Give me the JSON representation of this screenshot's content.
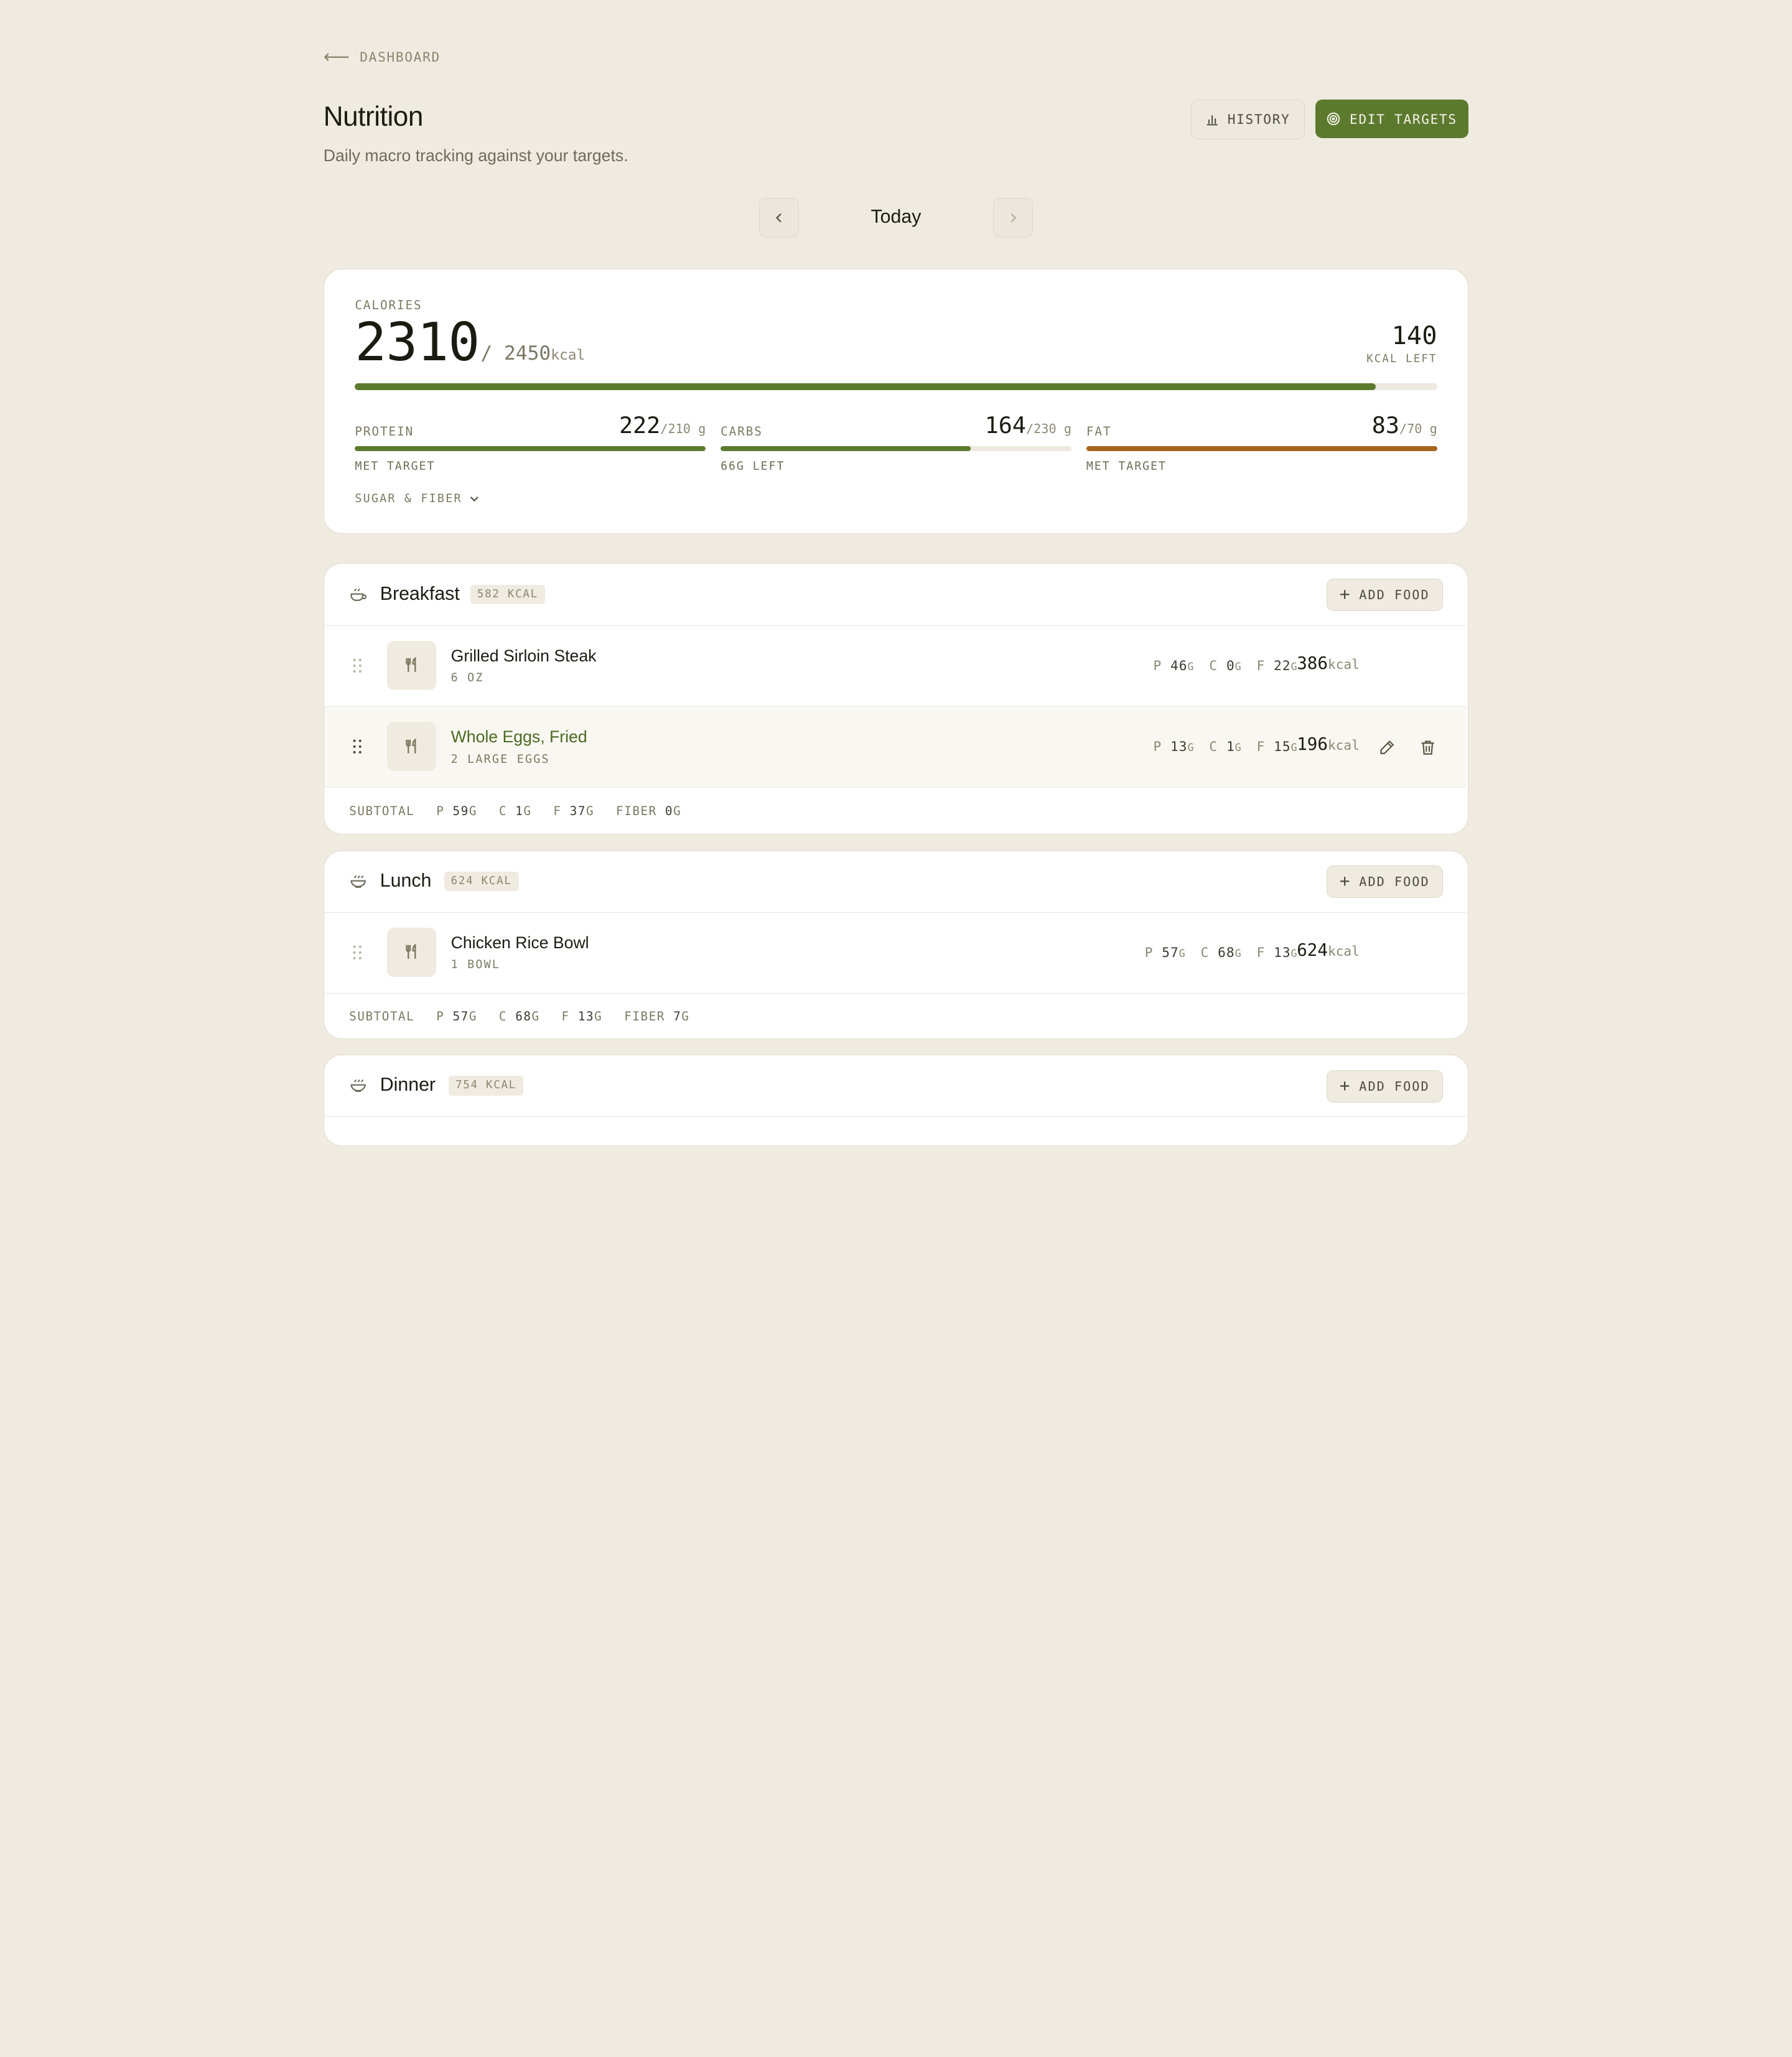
{
  "nav": {
    "back_label": "DASHBOARD"
  },
  "header": {
    "title": "Nutrition",
    "subtitle": "Daily macro tracking against your targets.",
    "history_label": "HISTORY",
    "edit_targets_label": "EDIT TARGETS"
  },
  "date_nav": {
    "label": "Today"
  },
  "calories": {
    "label": "CALORIES",
    "consumed": "2310",
    "target": "/ 2450",
    "unit": "kcal",
    "left_value": "140",
    "left_label": "KCAL LEFT",
    "progress": 0.943
  },
  "macros": [
    {
      "name": "PROTEIN",
      "value": "222",
      "target": "/210",
      "unit": "g",
      "status": "MET TARGET",
      "progress": 1.0,
      "color": "#5c7a2e"
    },
    {
      "name": "CARBS",
      "value": "164",
      "target": "/230",
      "unit": "g",
      "status": "66G LEFT",
      "progress": 0.713,
      "color": "#5c7a2e"
    },
    {
      "name": "FAT",
      "value": "83",
      "target": "/70",
      "unit": "g",
      "status": "MET TARGET",
      "progress": 1.0,
      "color": "#a8641c"
    }
  ],
  "sugar_fiber_label": "SUGAR & FIBER",
  "meals": {
    "breakfast": {
      "name": "Breakfast",
      "kcal": "582 KCAL",
      "add_label": "ADD FOOD",
      "items": [
        {
          "name": "Grilled Sirloin Steak",
          "serving": "6 OZ",
          "p": "46",
          "c": "0",
          "f": "22",
          "kcal": "386",
          "kcal_unit": "kcal"
        },
        {
          "name": "Whole Eggs, Fried",
          "serving": "2 LARGE EGGS",
          "p": "13",
          "c": "1",
          "f": "15",
          "kcal": "196",
          "kcal_unit": "kcal"
        }
      ],
      "subtotal": {
        "label": "SUBTOTAL",
        "p": "59",
        "c": "1",
        "f": "37",
        "fiber": "0"
      }
    },
    "lunch": {
      "name": "Lunch",
      "kcal": "624 KCAL",
      "add_label": "ADD FOOD",
      "items": [
        {
          "name": "Chicken Rice Bowl",
          "serving": "1 BOWL",
          "p": "57",
          "c": "68",
          "f": "13",
          "kcal": "624",
          "kcal_unit": "kcal"
        }
      ],
      "subtotal": {
        "label": "SUBTOTAL",
        "p": "57",
        "c": "68",
        "f": "13",
        "fiber": "7"
      }
    },
    "dinner": {
      "name": "Dinner",
      "kcal": "754 KCAL",
      "add_label": "ADD FOOD"
    }
  },
  "labels": {
    "p": "P",
    "c": "C",
    "f": "F",
    "fiber": "FIBER",
    "g": "G"
  },
  "colors": {
    "accent": "#5c7a2e",
    "fat": "#a8641c",
    "background": "#efebe1"
  }
}
